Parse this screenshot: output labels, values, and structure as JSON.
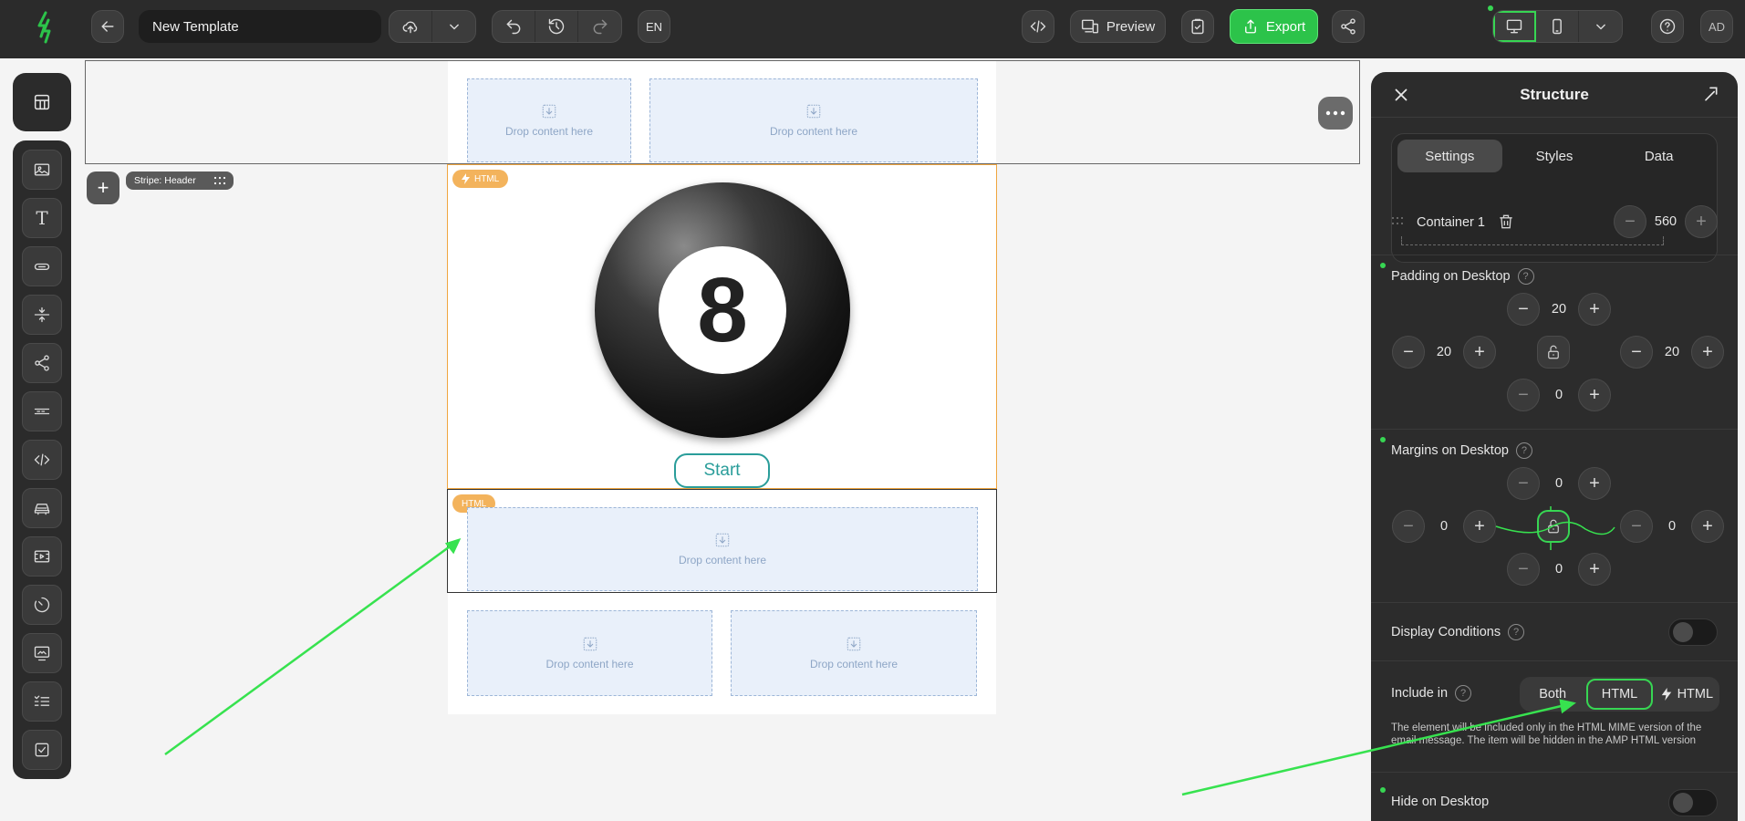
{
  "topbar": {
    "template_name": "New Template",
    "language": "EN",
    "preview_label": "Preview",
    "export_label": "Export",
    "avatar_initials": "AD"
  },
  "canvas": {
    "drop_label": "Drop content here",
    "stripe_tag": "Stripe: Header",
    "html_tag": "HTML",
    "ball_number": "8",
    "start_label": "Start"
  },
  "panel": {
    "title": "Structure",
    "tabs": [
      "Settings",
      "Styles",
      "Data"
    ],
    "container_label": "Container 1",
    "container_width": "560",
    "padding_label": "Padding on Desktop",
    "padding": {
      "top": "20",
      "left": "20",
      "right": "20",
      "bottom": "0"
    },
    "margins_label": "Margins on Desktop",
    "margins": {
      "top": "0",
      "left": "0",
      "right": "0",
      "bottom": "0"
    },
    "display_conditions_label": "Display Conditions",
    "include_in_label": "Include in",
    "include_options": [
      "Both",
      "HTML",
      "HTML"
    ],
    "include_selected": "HTML",
    "include_note": "The element will be included only in the HTML MIME version of the email message. The item will be hidden in the AMP HTML version",
    "hide_desktop_label": "Hide on Desktop"
  },
  "colors": {
    "accent_green": "#37d653",
    "export_green": "#2cc34a",
    "html_tag_orange": "#f3b35c",
    "start_teal": "#2a9d9a"
  }
}
